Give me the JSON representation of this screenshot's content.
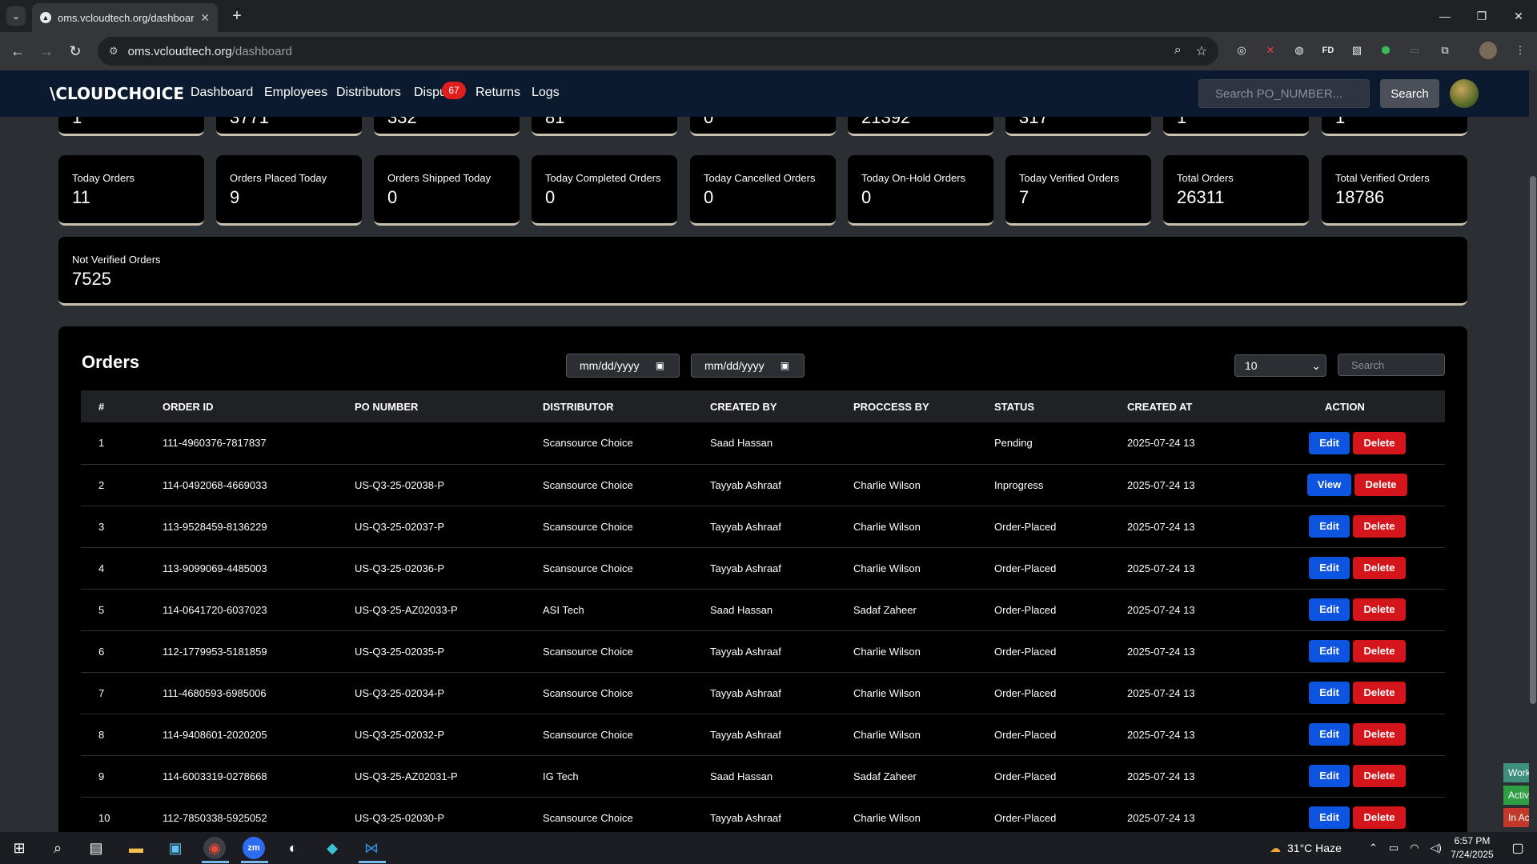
{
  "browser": {
    "tab_title": "oms.vcloudtech.org/dashboard",
    "url_host": "oms.vcloudtech.org",
    "url_path": "/dashboard"
  },
  "nav": {
    "logo": "CLOUDCHOICE",
    "links": [
      "Dashboard",
      "Employees",
      "Distributors",
      "Dispu",
      "Returns",
      "Logs"
    ],
    "disputes_badge": "67",
    "search_placeholder": "Search PO_NUMBER...",
    "search_button": "Search"
  },
  "top_partial_values": [
    "1",
    "3771",
    "332",
    "81",
    "0",
    "21392",
    "317",
    "1",
    "1"
  ],
  "stats": [
    {
      "label": "Today Orders",
      "value": "11"
    },
    {
      "label": "Orders Placed Today",
      "value": "9"
    },
    {
      "label": "Orders Shipped Today",
      "value": "0"
    },
    {
      "label": "Today Completed Orders",
      "value": "0"
    },
    {
      "label": "Today Cancelled Orders",
      "value": "0"
    },
    {
      "label": "Today On-Hold Orders",
      "value": "0"
    },
    {
      "label": "Today Verified Orders",
      "value": "7"
    },
    {
      "label": "Total Orders",
      "value": "26311"
    },
    {
      "label": "Total Verified Orders",
      "value": "18786"
    }
  ],
  "not_verified": {
    "label": "Not Verified Orders",
    "value": "7525"
  },
  "orders": {
    "title": "Orders",
    "date_from_placeholder": "mm/dd/yyyy",
    "date_to_placeholder": "mm/dd/yyyy",
    "page_size": "10",
    "search_placeholder": "Search",
    "columns": [
      "#",
      "ORDER ID",
      "PO NUMBER",
      "DISTRIBUTOR",
      "CREATED BY",
      "PROCCESS BY",
      "STATUS",
      "CREATED AT",
      "ACTION"
    ],
    "rows": [
      {
        "n": "1",
        "order_id": "111-4960376-7817837",
        "po": "",
        "distributor": "Scansource Choice",
        "created_by": "Saad Hassan",
        "process_by": "",
        "status": "Pending",
        "created_at": "2025-07-24 13",
        "primary": "Edit",
        "secondary": "Delete"
      },
      {
        "n": "2",
        "order_id": "114-0492068-4669033",
        "po": "US-Q3-25-02038-P",
        "distributor": "Scansource Choice",
        "created_by": "Tayyab Ashraaf",
        "process_by": "Charlie Wilson",
        "status": "Inprogress",
        "created_at": "2025-07-24 13",
        "primary": "View",
        "secondary": "Delete"
      },
      {
        "n": "3",
        "order_id": "113-9528459-8136229",
        "po": "US-Q3-25-02037-P",
        "distributor": "Scansource Choice",
        "created_by": "Tayyab Ashraaf",
        "process_by": "Charlie Wilson",
        "status": "Order-Placed",
        "created_at": "2025-07-24 13",
        "primary": "Edit",
        "secondary": "Delete"
      },
      {
        "n": "4",
        "order_id": "113-9099069-4485003",
        "po": "US-Q3-25-02036-P",
        "distributor": "Scansource Choice",
        "created_by": "Tayyab Ashraaf",
        "process_by": "Charlie Wilson",
        "status": "Order-Placed",
        "created_at": "2025-07-24 13",
        "primary": "Edit",
        "secondary": "Delete"
      },
      {
        "n": "5",
        "order_id": "114-0641720-6037023",
        "po": "US-Q3-25-AZ02033-P",
        "distributor": "ASI Tech",
        "created_by": "Saad Hassan",
        "process_by": "Sadaf Zaheer",
        "status": "Order-Placed",
        "created_at": "2025-07-24 13",
        "primary": "Edit",
        "secondary": "Delete"
      },
      {
        "n": "6",
        "order_id": "112-1779953-5181859",
        "po": "US-Q3-25-02035-P",
        "distributor": "Scansource Choice",
        "created_by": "Tayyab Ashraaf",
        "process_by": "Charlie Wilson",
        "status": "Order-Placed",
        "created_at": "2025-07-24 13",
        "primary": "Edit",
        "secondary": "Delete"
      },
      {
        "n": "7",
        "order_id": "111-4680593-6985006",
        "po": "US-Q3-25-02034-P",
        "distributor": "Scansource Choice",
        "created_by": "Tayyab Ashraaf",
        "process_by": "Charlie Wilson",
        "status": "Order-Placed",
        "created_at": "2025-07-24 13",
        "primary": "Edit",
        "secondary": "Delete"
      },
      {
        "n": "8",
        "order_id": "114-9408601-2020205",
        "po": "US-Q3-25-02032-P",
        "distributor": "Scansource Choice",
        "created_by": "Tayyab Ashraaf",
        "process_by": "Charlie Wilson",
        "status": "Order-Placed",
        "created_at": "2025-07-24 13",
        "primary": "Edit",
        "secondary": "Delete"
      },
      {
        "n": "9",
        "order_id": "114-6003319-0278668",
        "po": "US-Q3-25-AZ02031-P",
        "distributor": "IG Tech",
        "created_by": "Saad Hassan",
        "process_by": "Sadaf Zaheer",
        "status": "Order-Placed",
        "created_at": "2025-07-24 13",
        "primary": "Edit",
        "secondary": "Delete"
      },
      {
        "n": "10",
        "order_id": "112-7850338-5925052",
        "po": "US-Q3-25-02030-P",
        "distributor": "Scansource Choice",
        "created_by": "Tayyab Ashraaf",
        "process_by": "Charlie Wilson",
        "status": "Order-Placed",
        "created_at": "2025-07-24 13",
        "primary": "Edit",
        "secondary": "Delete"
      }
    ]
  },
  "side_tabs": [
    {
      "label": "Work",
      "color": "#3f8f7d"
    },
    {
      "label": "Active",
      "color": "#2f9e44"
    },
    {
      "label": "In Act",
      "color": "#c0392b"
    }
  ],
  "taskbar": {
    "weather": "31°C  Haze",
    "time": "6:57 PM",
    "date": "7/24/2025"
  },
  "colors": {
    "nav_bg": "#0b1a2e",
    "edit": "#0d55e0",
    "delete": "#d4151c",
    "badge": "#e01e1e"
  }
}
